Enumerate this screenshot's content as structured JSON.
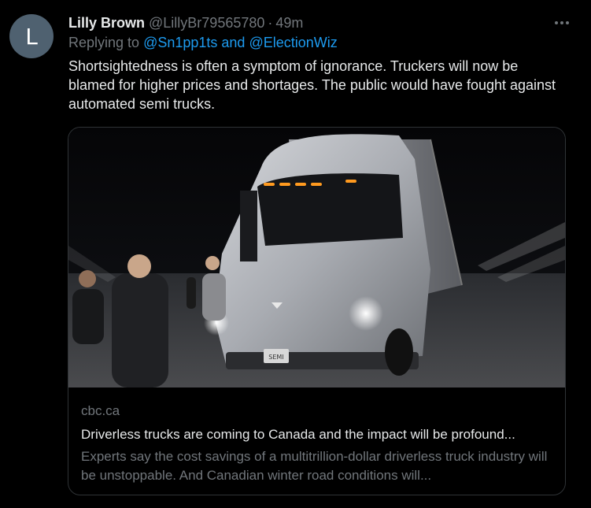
{
  "tweet": {
    "avatar_letter": "L",
    "display_name": "Lilly Brown",
    "handle": "@LillyBr79565780",
    "separator": "·",
    "time": "49m",
    "more_icon": "more-horizontal-icon",
    "replying_prefix": "Replying to",
    "replying_to": "@Sn1pp1ts and @ElectionWiz",
    "text": "Shortsightedness is often a symptom of ignorance. Truckers will now be blamed for higher prices and shortages. The public would have fought against automated semi trucks."
  },
  "card": {
    "image_description_icon": "truck-photo",
    "plate": "SEMI",
    "domain": "cbc.ca",
    "title": "Driverless trucks are coming to Canada and the impact will be profound...",
    "description": "Experts say the cost savings of a multitrillion-dollar driverless truck industry will be unstoppable. And Canadian winter road conditions will..."
  },
  "colors": {
    "background": "#000000",
    "text_primary": "#e7e9ea",
    "text_secondary": "#71767b",
    "accent": "#1d9bf0",
    "avatar_bg": "#4f6170",
    "border": "#2f3336"
  }
}
